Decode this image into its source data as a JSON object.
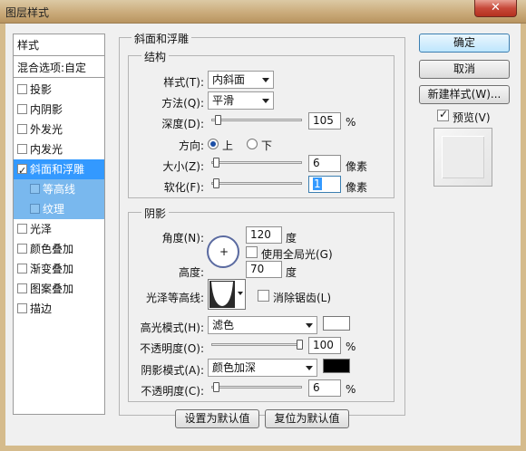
{
  "window": {
    "title": "图层样式",
    "close": "✕"
  },
  "styles": {
    "header": "样式",
    "blend": "混合选项:自定",
    "items": [
      {
        "label": "投影",
        "checked": false
      },
      {
        "label": "内阴影",
        "checked": false
      },
      {
        "label": "外发光",
        "checked": false
      },
      {
        "label": "内发光",
        "checked": false
      },
      {
        "label": "斜面和浮雕",
        "checked": true
      },
      {
        "label": "等高线",
        "checked": false
      },
      {
        "label": "纹理",
        "checked": false
      },
      {
        "label": "光泽",
        "checked": false
      },
      {
        "label": "颜色叠加",
        "checked": false
      },
      {
        "label": "渐变叠加",
        "checked": false
      },
      {
        "label": "图案叠加",
        "checked": false
      },
      {
        "label": "描边",
        "checked": false
      }
    ]
  },
  "bevel": {
    "title": "斜面和浮雕",
    "structure": {
      "title": "结构",
      "style_label": "样式(T):",
      "style_value": "内斜面",
      "technique_label": "方法(Q):",
      "technique_value": "平滑",
      "depth_label": "深度(D):",
      "depth_value": "105",
      "depth_unit": "%",
      "direction_label": "方向:",
      "dir_up": "上",
      "dir_down": "下",
      "size_label": "大小(Z):",
      "size_value": "6",
      "size_unit": "像素",
      "soften_label": "软化(F):",
      "soften_value": "1",
      "soften_unit": "像素"
    },
    "shading": {
      "title": "阴影",
      "angle_label": "角度(N):",
      "angle_value": "120",
      "angle_unit": "度",
      "global_light": "使用全局光(G)",
      "altitude_label": "高度:",
      "altitude_value": "70",
      "altitude_unit": "度",
      "gloss_label": "光泽等高线:",
      "antialias": "消除锯齿(L)",
      "highlight_label": "高光模式(H):",
      "highlight_mode": "滤色",
      "highlight_color": "#ffffff",
      "hl_opacity_label": "不透明度(O):",
      "hl_opacity_value": "100",
      "hl_opacity_unit": "%",
      "shadow_label": "阴影模式(A):",
      "shadow_mode": "颜色加深",
      "shadow_color": "#000000",
      "sh_opacity_label": "不透明度(C):",
      "sh_opacity_value": "6",
      "sh_opacity_unit": "%"
    },
    "set_default": "设置为默认值",
    "reset_default": "复位为默认值"
  },
  "buttons": {
    "ok": "确定",
    "cancel": "取消",
    "new_style": "新建样式(W)...",
    "preview": "预览(V)"
  }
}
